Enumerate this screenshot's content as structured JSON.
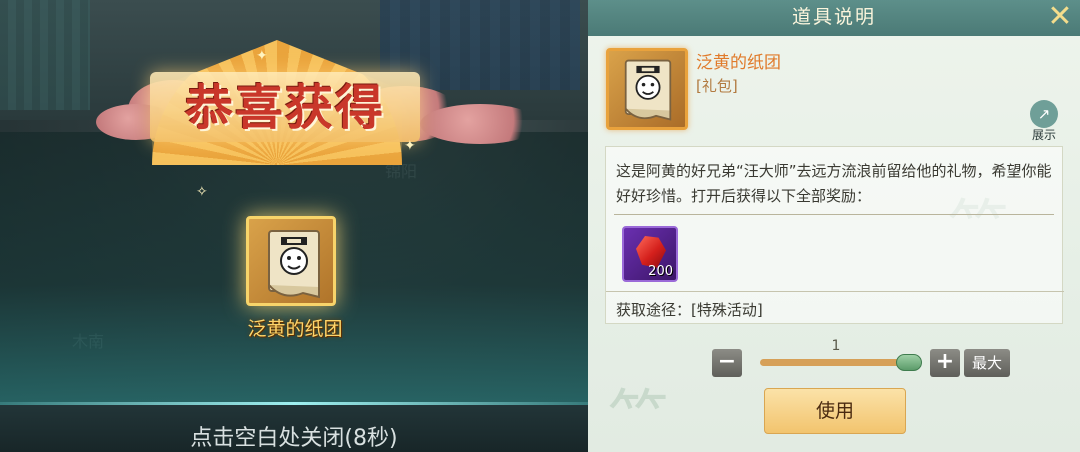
{
  "reward_popup": {
    "title": "恭喜获得",
    "item_name": "泛黄的纸团",
    "close_hint": "点击空白处关闭(8秒)",
    "scene_labels": [
      "木南",
      "锦阳"
    ]
  },
  "item_panel": {
    "title": "道具说明",
    "close_icon": "close-icon",
    "item_name": "泛黄的纸团",
    "item_type": "[礼包]",
    "share_label": "展示",
    "description": "这是阿黄的好兄弟“汪大师”去远方流浪前留给他的礼物，希望你能好好珍惜。打开后获得以下全部奖励：",
    "rewards": [
      {
        "icon": "red-gem-icon",
        "count": "200"
      }
    ],
    "source": "获取途径：[特殊活动]",
    "quantity": "1",
    "quantity_max_label": "最大",
    "minus_label": "−",
    "plus_label": "+",
    "use_label": "使用"
  },
  "colors": {
    "accent_orange": "#e07a2a",
    "header_teal": "#5d8f8a",
    "title_red": "#c9372a",
    "gold": "#ffd56a"
  }
}
